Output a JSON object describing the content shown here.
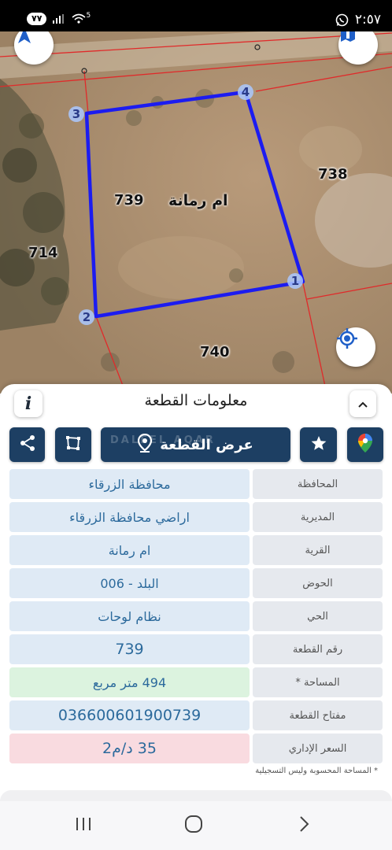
{
  "status_bar": {
    "time": "٢:٥٧",
    "battery": "٧٧",
    "network_badge": "5"
  },
  "map": {
    "parcels": {
      "current": "739",
      "east": "738",
      "west": "714",
      "south": "740"
    },
    "village_label": "ام رمانة",
    "vertices": [
      "1",
      "2",
      "3",
      "4"
    ],
    "boundary_color": "#1c1cf0",
    "neighbor_line_color": "#e02a2a"
  },
  "panel": {
    "title": "معلومات القطعة",
    "show_parcel_label": "عرض القطعة",
    "watermark": "DALEEL AQAR",
    "rows": [
      {
        "label": "المحافظة",
        "value": "محافظة الزرقاء"
      },
      {
        "label": "المديرية",
        "value": "اراضي محافظة الزرقاء"
      },
      {
        "label": "القرية",
        "value": "ام رمانة"
      },
      {
        "label": "الحوض",
        "value": "البلد - 006"
      },
      {
        "label": "الحي",
        "value": "نظام لوحات"
      },
      {
        "label": "رقم القطعة",
        "value": "739"
      },
      {
        "label": "المساحة *",
        "value": "494  متر مربع"
      },
      {
        "label": "مفتاح القطعة",
        "value": "036600601900739"
      },
      {
        "label": "السعر الإداري",
        "value": "35 د/م2"
      }
    ],
    "footnote": "* المساحة المحسوبة وليس التسجيلية"
  },
  "colors": {
    "primary": "#1d3f63",
    "value_text": "#2c6a9c",
    "value_bg": "#dfeaf5",
    "area_bg": "#dcf3df",
    "price_bg": "#f9dbe0"
  },
  "icons": {
    "compass": "compass-icon",
    "layers": "layers-icon",
    "locate": "my-location-icon",
    "info": "info-icon",
    "collapse": "chevron-up-icon",
    "share": "share-icon",
    "area": "area-measure-icon",
    "pin": "location-pin-icon",
    "star": "star-icon",
    "gmaps": "google-maps-icon"
  }
}
